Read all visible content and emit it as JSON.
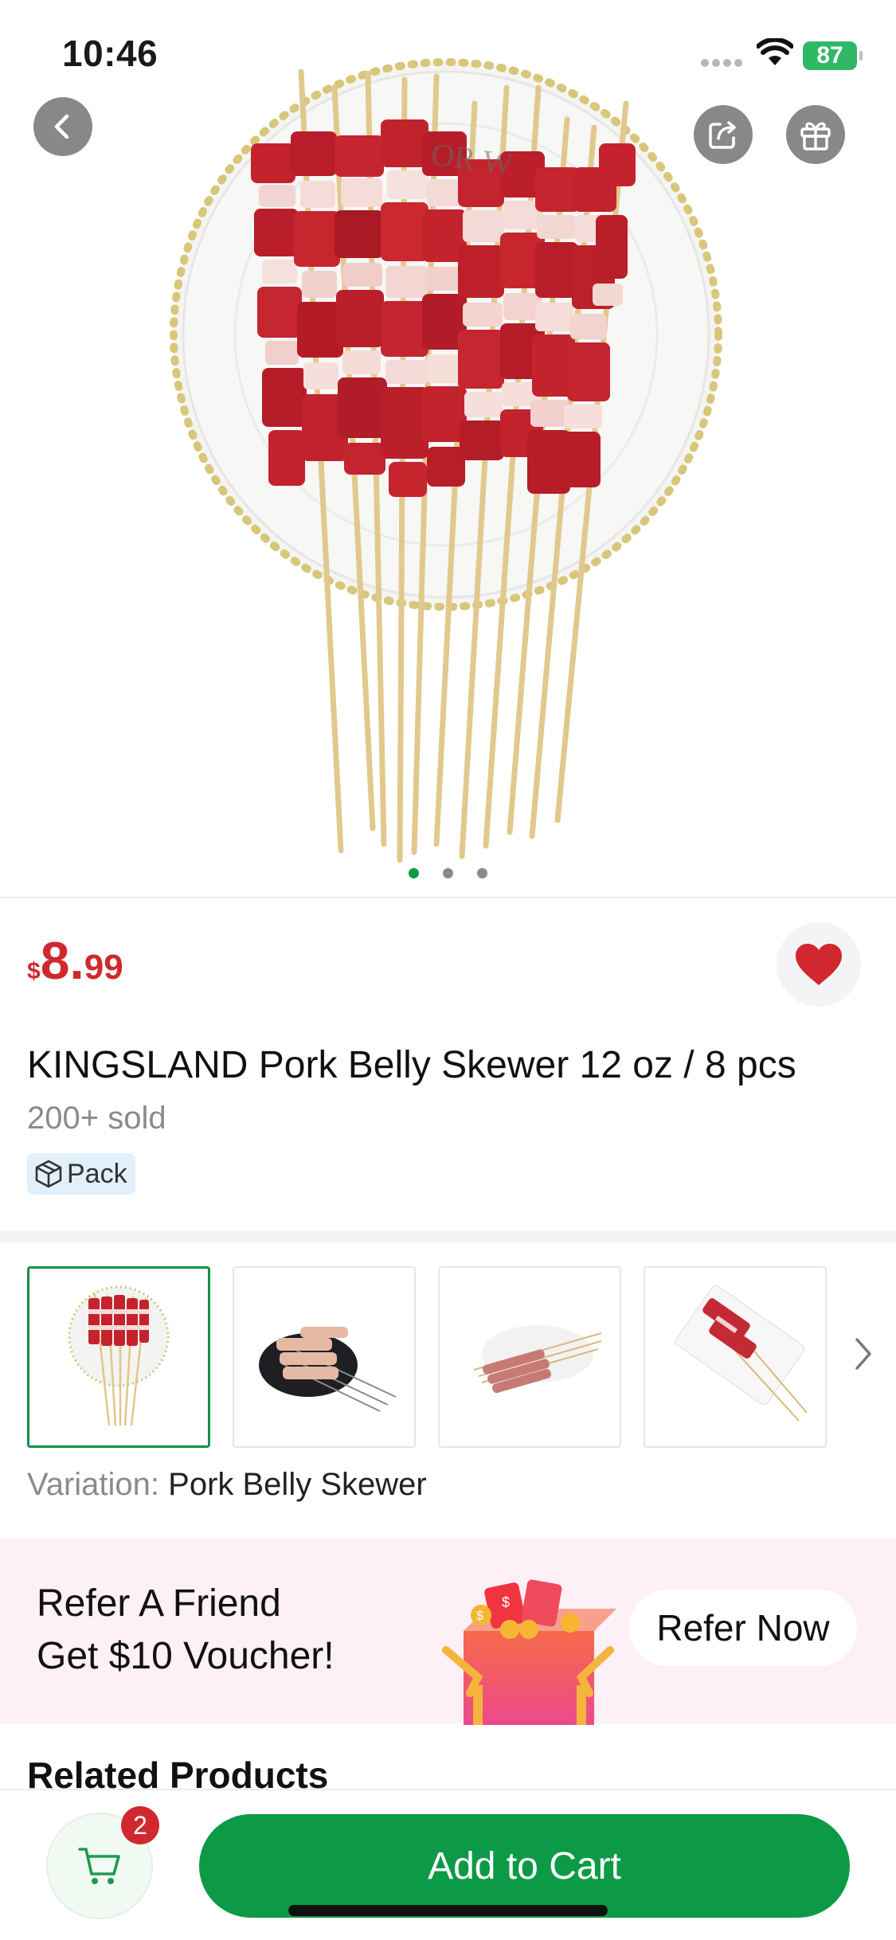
{
  "status_bar": {
    "time": "10:46",
    "battery": "87"
  },
  "hero": {
    "image_count": 3,
    "active_index": 0
  },
  "product": {
    "currency": "$",
    "price_int": "8.",
    "price_dec": "99",
    "title": "KINGSLAND Pork Belly Skewer 12 oz / 8 pcs",
    "sold": "200+ sold",
    "tag": "Pack"
  },
  "variation": {
    "label": "Variation: ",
    "value": "Pork Belly Skewer",
    "thumbnail_count": 4,
    "selected_index": 0
  },
  "refer": {
    "line1": "Refer A Friend",
    "line2": "Get $10 Voucher!",
    "button": "Refer Now"
  },
  "related": {
    "title": "Related Products"
  },
  "bottom_bar": {
    "cart_count": "2",
    "add_to_cart": "Add to Cart"
  },
  "colors": {
    "brand_green": "#0c9a46",
    "price_red": "#d0282e",
    "battery_green": "#2fb866"
  }
}
